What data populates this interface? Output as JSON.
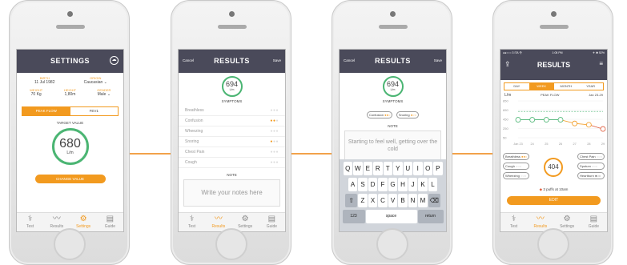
{
  "screen1": {
    "title": "SETTINGS",
    "birth_label": "BIRTH",
    "birth": "11 Jul 1982",
    "origin_label": "ORIGIN",
    "origin": "Caucasian",
    "weight_label": "WEIGHT",
    "weight": "70 Kg",
    "height_label": "HEIGHT",
    "height": "1,80m",
    "gender_label": "GENDER",
    "gender": "Male",
    "seg_peak": "PEAK FLOW",
    "seg_fev": "FEV1",
    "target_label": "TARGET VALUE",
    "target": "680",
    "unit": "L/m",
    "change": "CHANGE VALUE"
  },
  "tabs": {
    "test": "Test",
    "results": "Results",
    "settings": "Settings",
    "guide": "Guide"
  },
  "screen2": {
    "cancel": "Cancel",
    "title": "RESULTS",
    "save": "Save",
    "value": "694",
    "unit": "L/m",
    "symptoms": "SYMPTOMS",
    "items": [
      "Breathless",
      "Confusion",
      "Wheezing",
      "Snoring",
      "Chest Pain",
      "Cough"
    ],
    "note": "NOTE",
    "placeholder": "Write your notes here"
  },
  "screen3": {
    "cancel": "Cancel",
    "title": "RESULTS",
    "save": "Save",
    "value": "694",
    "unit": "L/m",
    "symptoms": "SYMPTOMS",
    "pill1": "Confusion",
    "pill2": "Snoring",
    "note": "NOTE",
    "note_text": "Starting to feel well, getting over the cold",
    "row1": [
      "Q",
      "W",
      "E",
      "R",
      "T",
      "Y",
      "U",
      "I",
      "O",
      "P"
    ],
    "row2": [
      "A",
      "S",
      "D",
      "F",
      "G",
      "H",
      "J",
      "K",
      "L"
    ],
    "row3": [
      "Z",
      "X",
      "C",
      "V",
      "B",
      "N",
      "M"
    ],
    "key_123": "123",
    "key_space": "space",
    "key_return": "return"
  },
  "screen4": {
    "status_left": "●●○○○ 3 ITA 令",
    "status_time": "1:08 PM",
    "status_right": "✈ ✱ 52%",
    "title": "RESULTS",
    "seg": [
      "DAY",
      "WEEK",
      "MONTH",
      "YEAR"
    ],
    "unit": "L/m",
    "chart_title": "PEAK FLOW",
    "range": "Jan 23-29",
    "reading": "404",
    "pills_left": [
      "Breathless",
      "Cough",
      "Wheezing"
    ],
    "pills_right": [
      "Chest Pain",
      "Sputum",
      "Heartburn"
    ],
    "puffs": "3 puffs at 10am",
    "edit": "EDIT"
  },
  "chart_data": {
    "type": "line",
    "categories": [
      "Jan 23",
      "24",
      "25",
      "26",
      "27",
      "28",
      "29"
    ],
    "values": [
      440,
      440,
      440,
      440,
      360,
      330,
      240
    ],
    "yticks": [
      50,
      250,
      450,
      650,
      850
    ],
    "ylim": [
      50,
      850
    ]
  }
}
